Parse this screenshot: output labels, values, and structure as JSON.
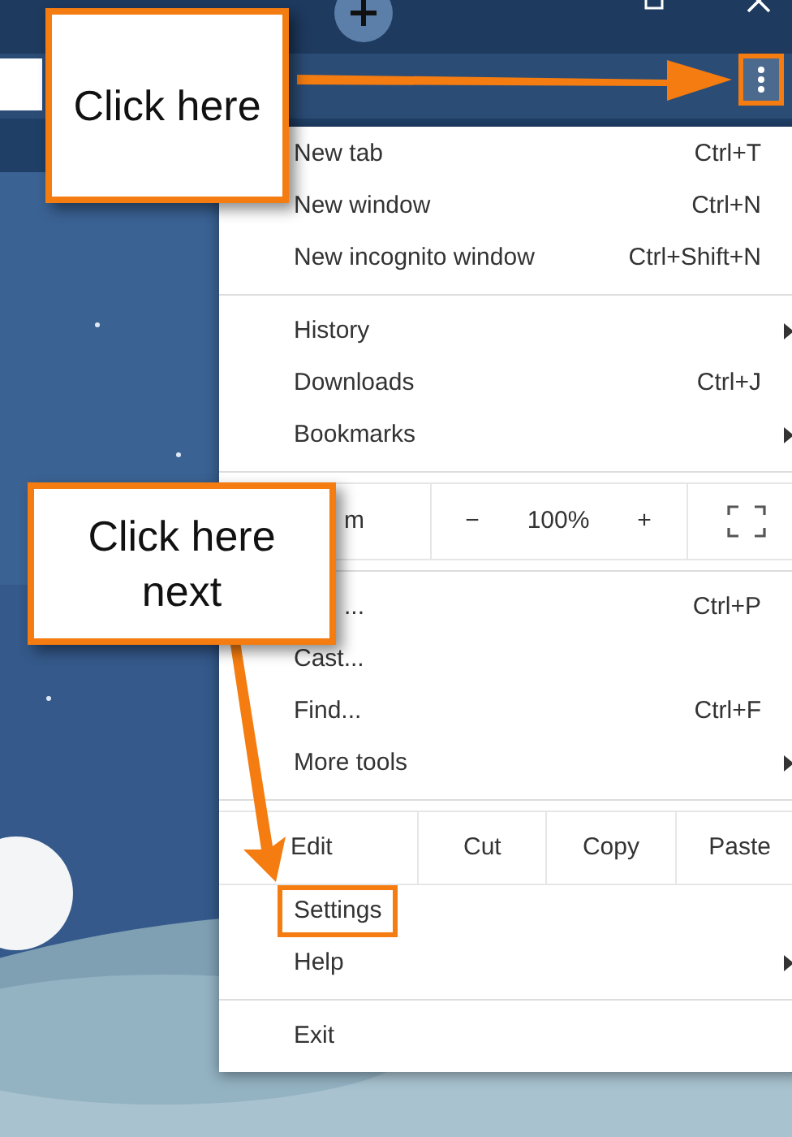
{
  "callouts": [
    {
      "text": "Click here"
    },
    {
      "text": "Click here\nnext"
    }
  ],
  "menu": {
    "items": [
      {
        "kind": "item",
        "label": "New tab",
        "shortcut": "Ctrl+T",
        "submenu": false,
        "highlighted": false
      },
      {
        "kind": "item",
        "label": "New window",
        "shortcut": "Ctrl+N",
        "submenu": false,
        "highlighted": false
      },
      {
        "kind": "item",
        "label": "New incognito window",
        "shortcut": "Ctrl+Shift+N",
        "submenu": false,
        "highlighted": false
      },
      {
        "kind": "separator"
      },
      {
        "kind": "item",
        "label": "History",
        "submenu": true,
        "highlighted": false
      },
      {
        "kind": "item",
        "label": "Downloads",
        "shortcut": "Ctrl+J",
        "submenu": false,
        "highlighted": false
      },
      {
        "kind": "item",
        "label": "Bookmarks",
        "submenu": true,
        "highlighted": false
      },
      {
        "kind": "separator"
      },
      {
        "kind": "zoom",
        "label": "m",
        "minus": "−",
        "value": "100%",
        "plus": "+"
      },
      {
        "kind": "separator"
      },
      {
        "kind": "covered_item",
        "label": "...",
        "shortcut": "Ctrl+P"
      },
      {
        "kind": "item",
        "label": "Cast...",
        "submenu": false,
        "highlighted": false
      },
      {
        "kind": "item",
        "label": "Find...",
        "shortcut": "Ctrl+F",
        "submenu": false,
        "highlighted": false
      },
      {
        "kind": "item",
        "label": "More tools",
        "submenu": true,
        "highlighted": false
      },
      {
        "kind": "separator"
      },
      {
        "kind": "edit",
        "label": "Edit",
        "actions": [
          "Cut",
          "Copy",
          "Paste"
        ]
      },
      {
        "kind": "item",
        "label": "Settings",
        "submenu": false,
        "highlighted": true
      },
      {
        "kind": "item",
        "label": "Help",
        "submenu": true,
        "highlighted": false
      },
      {
        "kind": "separator"
      },
      {
        "kind": "item",
        "label": "Exit",
        "submenu": false,
        "highlighted": false
      }
    ]
  }
}
